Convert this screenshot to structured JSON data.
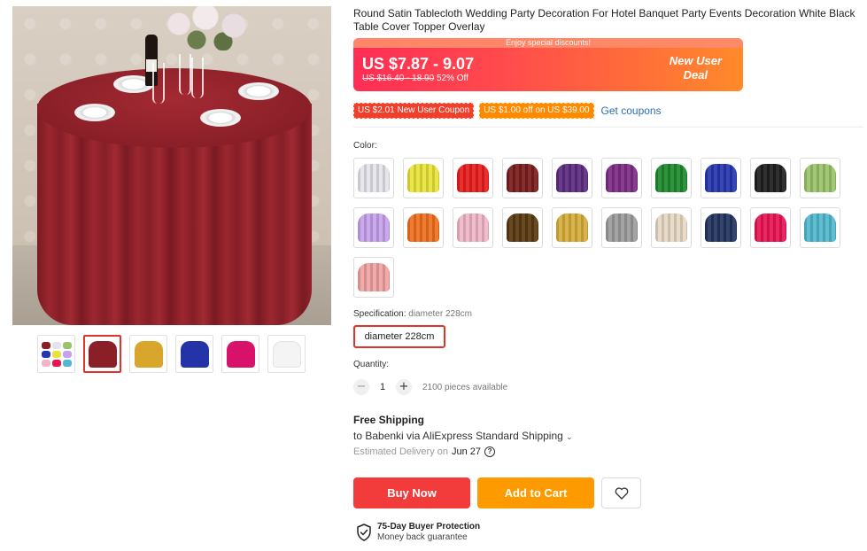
{
  "product": {
    "title": "Round Satin Tablecloth Wedding Party Decoration For Hotel Banquet Party Events Decoration White Black Table Cover Topper Overlay"
  },
  "gallery": {
    "thumbnails": [
      {
        "name": "multicolor-collage"
      },
      {
        "name": "burgundy",
        "color": "#8b1f27"
      },
      {
        "name": "gold",
        "color": "#d9a62c"
      },
      {
        "name": "royal-blue",
        "color": "#2433a8"
      },
      {
        "name": "rose-red",
        "color": "#d8126b"
      },
      {
        "name": "white",
        "color": "#f4f4f4"
      }
    ]
  },
  "price": {
    "banner_top": "Enjoy special discounts!",
    "current": "US $7.87 - 9.07",
    "original": "US $16.40 - 18.90",
    "discount": "52% Off",
    "deal_line1": "New User",
    "deal_line2": "Deal",
    "colors": {
      "start": "#ff2d55",
      "end": "#ff8a2a"
    }
  },
  "coupons": {
    "new_user": "US $2.01 New User Coupon",
    "off": "US $1.00 off on US $39.00",
    "get_label": "Get coupons"
  },
  "color_section": {
    "label": "Color:",
    "swatches": [
      "#e4e4ea",
      "#e8e33a",
      "#e81d1d",
      "#7a1c1c",
      "#5b2c80",
      "#7e2c86",
      "#1e8b2e",
      "#2736b0",
      "#1f1f1f",
      "#9ac46a",
      "#c7a2ec",
      "#f0701e",
      "#f0b6c8",
      "#5a3a12",
      "#d6ae3c",
      "#9c9c9c",
      "#e6d8c4",
      "#23345e",
      "#e81553",
      "#52b8cf",
      "#f0a2a2"
    ]
  },
  "specification": {
    "label": "Specification:",
    "selected": "diameter 228cm",
    "option": "diameter 228cm"
  },
  "quantity": {
    "label": "Quantity:",
    "value": "1",
    "minus": "−",
    "plus": "+",
    "available": "2100 pieces available"
  },
  "shipping": {
    "title": "Free Shipping",
    "to": "to Babenki via AliExpress Standard Shipping",
    "delivery_label": "Estimated Delivery on",
    "delivery_date": "Jun 27",
    "help": "?"
  },
  "actions": {
    "buy_now": "Buy Now",
    "add_to_cart": "Add to Cart",
    "buy_color": "#f23c3c",
    "cart_color": "#fd9a00"
  },
  "protection": {
    "title": "75-Day Buyer Protection",
    "subtitle": "Money back guarantee"
  }
}
